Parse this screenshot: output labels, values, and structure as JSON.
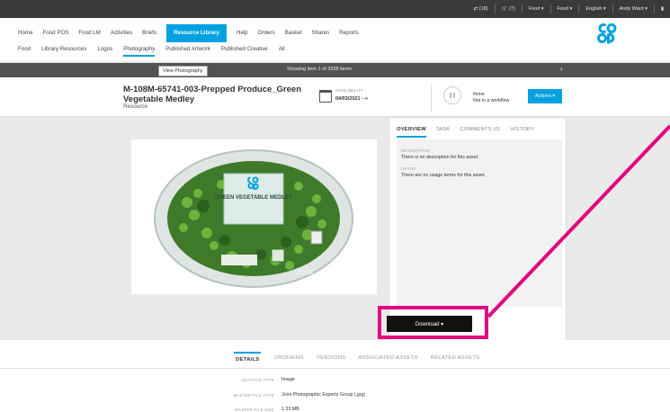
{
  "topbar": {
    "items": [
      "⇄ (18)",
      "🛒 (7)",
      "Food ▾",
      "Food ▾",
      "English ▾",
      "Andy Ward ▾",
      "▮"
    ]
  },
  "nav": {
    "primary": [
      "Home",
      "Food POS",
      "Food LM",
      "Activities",
      "Briefs",
      "Resource Library",
      "Help",
      "Orders",
      "Basket",
      "Shares",
      "Reports"
    ],
    "primary_active": "Resource Library",
    "secondary": [
      "Food",
      "Library Resources",
      "Logos",
      "Photography",
      "Published Artwork",
      "Published Creative",
      "All"
    ],
    "secondary_active": "Photography"
  },
  "logo_text": "co op",
  "infobar": {
    "tooltip": "View Photography",
    "showing": "Showing item 1 of 3358 items",
    "next": "›"
  },
  "asset": {
    "title": "M-108M-65741-003-Prepped Produce_Green Vegetable Medley",
    "type": "Resource",
    "availability_label": "AVAILABILITY :",
    "availability_value": "04/03/2021 - ∞",
    "workflow_status": "None",
    "workflow_detail": "Not in a workflow",
    "actions_label": "Actions ▾"
  },
  "product": {
    "brand": "co op",
    "name": "GREEN VEGETABLE MEDLEY",
    "weight": "260g"
  },
  "side": {
    "tabs": [
      "OVERVIEW",
      "TASK",
      "COMMENTS (0)",
      "HISTORY"
    ],
    "active_tab": "OVERVIEW",
    "description_label": "DESCRIPTION",
    "description_text": "There is no description for this asset.",
    "usage_label": "USAGE",
    "usage_text": "There are no usage terms for this asset.",
    "download_label": "Download ▾"
  },
  "details": {
    "tabs": [
      "DETAILS",
      "ORDERING",
      "VERSIONS",
      "ASSOCIATED ASSETS",
      "RELATED ASSETS"
    ],
    "active_tab": "DETAILS",
    "rows": [
      {
        "label": "ADAPTOR TYPE",
        "value": "Image"
      },
      {
        "label": "MASTER FILE TYPE",
        "value": "Joint Photographic Experts Group (.jpg)"
      },
      {
        "label": "MASTER FILE SIZE",
        "value": "1.33 MB"
      }
    ]
  },
  "colors": {
    "accent": "#00a1e0",
    "highlight": "#e2087d",
    "topbar": "#3a3a3a"
  }
}
